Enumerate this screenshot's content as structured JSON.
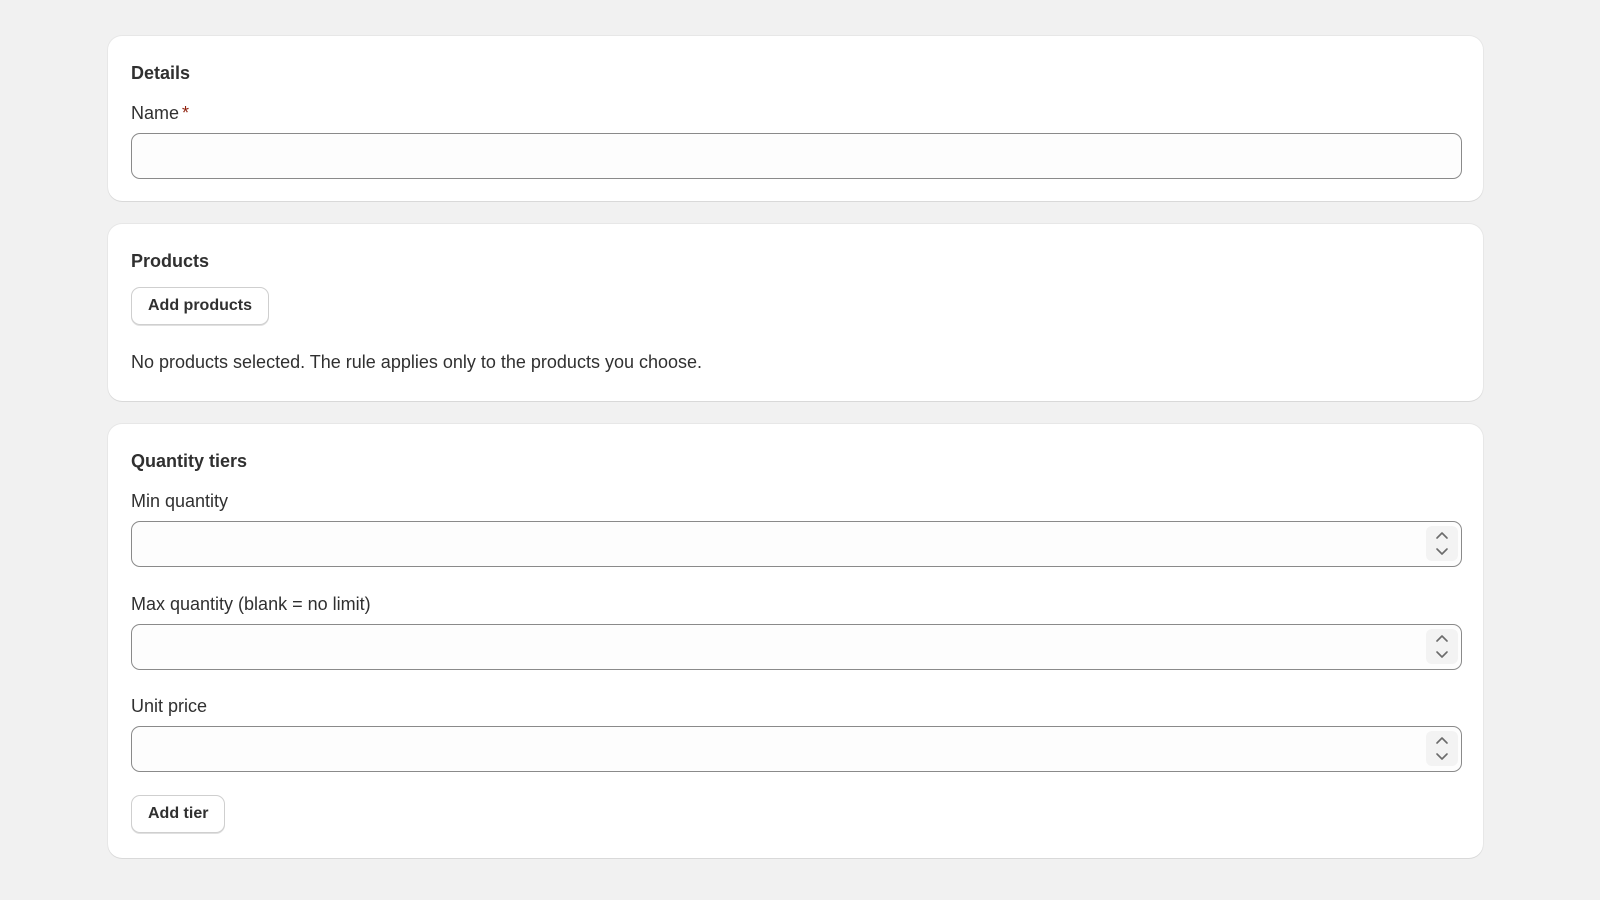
{
  "details": {
    "title": "Details",
    "name_label": "Name",
    "required_marker": "*",
    "name_value": "",
    "name_placeholder": ""
  },
  "products": {
    "title": "Products",
    "add_button": "Add products",
    "empty_text": "No products selected. The rule applies only to the products you choose."
  },
  "quantity_tiers": {
    "title": "Quantity tiers",
    "min_label": "Min quantity",
    "min_value": "",
    "max_label": "Max quantity (blank = no limit)",
    "max_value": "",
    "price_label": "Unit price",
    "price_value": "",
    "add_tier_button": "Add tier"
  },
  "icons": {
    "stepper_up": "chevron-up-icon",
    "stepper_down": "chevron-down-icon"
  },
  "colors": {
    "page_background": "#f1f1f1",
    "card_background": "#ffffff",
    "required_marker": "#8e1f0b",
    "input_border": "#8a8a8a"
  }
}
